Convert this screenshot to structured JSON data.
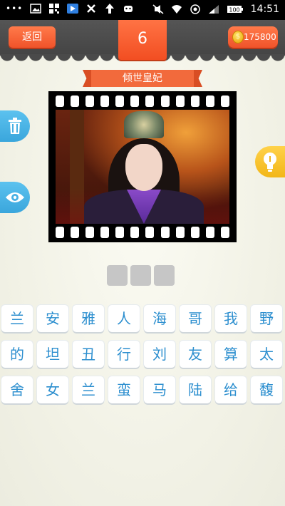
{
  "status_bar": {
    "time": "14:51",
    "left_icons": [
      "more-dots-icon",
      "picture-icon",
      "qr-icon",
      "play-store-icon",
      "sync-icon",
      "upload-icon",
      "android-icon"
    ],
    "right_icons": [
      "mute-icon",
      "wifi-icon",
      "data-icon",
      "signal-icon",
      "battery-icon"
    ]
  },
  "header": {
    "back_label": "返回",
    "level": "6",
    "coins": "175800"
  },
  "puzzle": {
    "hint_title": "倾世皇妃",
    "answer_slots": 3
  },
  "side_buttons": {
    "left_top": "trash-icon",
    "left_bottom": "eye-icon",
    "right": "lightbulb-icon"
  },
  "letters": [
    [
      "兰",
      "安",
      "雅",
      "人",
      "海",
      "哥",
      "我",
      "野"
    ],
    [
      "的",
      "坦",
      "丑",
      "行",
      "刘",
      "友",
      "算",
      "太"
    ],
    [
      "舍",
      "女",
      "兰",
      "蛮",
      "马",
      "陆",
      "给",
      "馥"
    ]
  ],
  "colors": {
    "accent": "#f2582a",
    "key_text": "#2d8fcf",
    "side_blue": "#47b0e4",
    "side_yellow": "#f7c02c"
  }
}
